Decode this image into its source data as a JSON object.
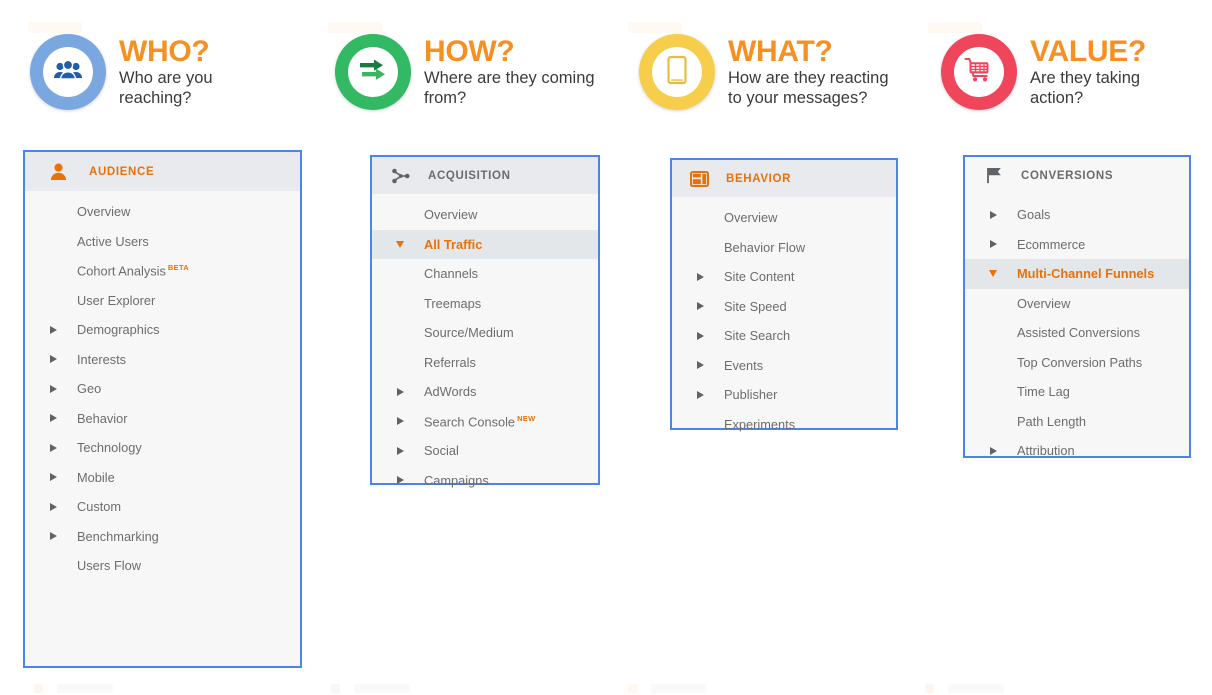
{
  "headers": [
    {
      "id": "who",
      "title": "WHO?",
      "subtitle": "Who are you\nreaching?",
      "icon": "people-icon",
      "ring_color": "#7ba7e1",
      "icon_color": "#1f5fa9"
    },
    {
      "id": "how",
      "title": "HOW?",
      "subtitle": "Where are they coming\nfrom?",
      "icon": "arrows-right-icon",
      "ring_color": "#33b864",
      "icon_color": "#1f7a3f"
    },
    {
      "id": "what",
      "title": "WHAT?",
      "subtitle": "How are they reacting\nto your messages?",
      "icon": "tablet-icon",
      "ring_color": "#f7ce4b",
      "icon_color": "#e5b63a"
    },
    {
      "id": "value",
      "title": "VALUE?",
      "subtitle": "Are they taking\naction?",
      "icon": "shopping-cart-icon",
      "ring_color": "#f0465c",
      "icon_color": "#f0465c"
    }
  ],
  "panels": [
    {
      "id": "audience",
      "header_label": "AUDIENCE",
      "header_icon": "person-icon",
      "header_label_color": "orange",
      "items": [
        {
          "label": "Overview",
          "arrow": "none",
          "selected": false,
          "tag": ""
        },
        {
          "label": "Active Users",
          "arrow": "none",
          "selected": false,
          "tag": ""
        },
        {
          "label": "Cohort Analysis",
          "arrow": "none",
          "selected": false,
          "tag": "BETA"
        },
        {
          "label": "User Explorer",
          "arrow": "none",
          "selected": false,
          "tag": ""
        },
        {
          "label": "Demographics",
          "arrow": "right",
          "selected": false,
          "tag": ""
        },
        {
          "label": "Interests",
          "arrow": "right",
          "selected": false,
          "tag": ""
        },
        {
          "label": "Geo",
          "arrow": "right",
          "selected": false,
          "tag": ""
        },
        {
          "label": "Behavior",
          "arrow": "right",
          "selected": false,
          "tag": ""
        },
        {
          "label": "Technology",
          "arrow": "right",
          "selected": false,
          "tag": ""
        },
        {
          "label": "Mobile",
          "arrow": "right",
          "selected": false,
          "tag": ""
        },
        {
          "label": "Custom",
          "arrow": "right",
          "selected": false,
          "tag": ""
        },
        {
          "label": "Benchmarking",
          "arrow": "right",
          "selected": false,
          "tag": ""
        },
        {
          "label": "Users Flow",
          "arrow": "none",
          "selected": false,
          "tag": ""
        }
      ]
    },
    {
      "id": "acquisition",
      "header_label": "ACQUISITION",
      "header_icon": "share-nodes-icon",
      "header_label_color": "grey",
      "items": [
        {
          "label": "Overview",
          "arrow": "none",
          "selected": false,
          "tag": ""
        },
        {
          "label": "All Traffic",
          "arrow": "down",
          "selected": true,
          "tag": ""
        },
        {
          "label": "Channels",
          "arrow": "none",
          "selected": false,
          "tag": ""
        },
        {
          "label": "Treemaps",
          "arrow": "none",
          "selected": false,
          "tag": ""
        },
        {
          "label": "Source/Medium",
          "arrow": "none",
          "selected": false,
          "tag": ""
        },
        {
          "label": "Referrals",
          "arrow": "none",
          "selected": false,
          "tag": ""
        },
        {
          "label": "AdWords",
          "arrow": "right",
          "selected": false,
          "tag": ""
        },
        {
          "label": "Search Console",
          "arrow": "right",
          "selected": false,
          "tag": "NEW"
        },
        {
          "label": "Social",
          "arrow": "right",
          "selected": false,
          "tag": ""
        },
        {
          "label": "Campaigns",
          "arrow": "right",
          "selected": false,
          "tag": ""
        }
      ]
    },
    {
      "id": "behavior",
      "header_label": "BEHAVIOR",
      "header_icon": "pages-icon",
      "header_label_color": "orange",
      "items": [
        {
          "label": "Overview",
          "arrow": "none",
          "selected": false,
          "tag": ""
        },
        {
          "label": "Behavior Flow",
          "arrow": "none",
          "selected": false,
          "tag": ""
        },
        {
          "label": "Site Content",
          "arrow": "right",
          "selected": false,
          "tag": ""
        },
        {
          "label": "Site Speed",
          "arrow": "right",
          "selected": false,
          "tag": ""
        },
        {
          "label": "Site Search",
          "arrow": "right",
          "selected": false,
          "tag": ""
        },
        {
          "label": "Events",
          "arrow": "right",
          "selected": false,
          "tag": ""
        },
        {
          "label": "Publisher",
          "arrow": "right",
          "selected": false,
          "tag": ""
        },
        {
          "label": "Experiments",
          "arrow": "none",
          "selected": false,
          "tag": ""
        }
      ]
    },
    {
      "id": "conversions",
      "header_label": "CONVERSIONS",
      "header_icon": "flag-icon",
      "header_label_color": "grey",
      "items": [
        {
          "label": "Goals",
          "arrow": "right",
          "selected": false,
          "tag": ""
        },
        {
          "label": "Ecommerce",
          "arrow": "right",
          "selected": false,
          "tag": ""
        },
        {
          "label": "Multi-Channel Funnels",
          "arrow": "down",
          "selected": true,
          "tag": ""
        },
        {
          "label": "Overview",
          "arrow": "none",
          "selected": false,
          "tag": ""
        },
        {
          "label": "Assisted Conversions",
          "arrow": "none",
          "selected": false,
          "tag": ""
        },
        {
          "label": "Top Conversion Paths",
          "arrow": "none",
          "selected": false,
          "tag": ""
        },
        {
          "label": "Time Lag",
          "arrow": "none",
          "selected": false,
          "tag": ""
        },
        {
          "label": "Path Length",
          "arrow": "none",
          "selected": false,
          "tag": ""
        },
        {
          "label": "Attribution",
          "arrow": "right",
          "selected": false,
          "tag": ""
        }
      ]
    }
  ],
  "colors": {
    "accent_orange": "#e8710a",
    "title_orange": "#f79022",
    "panel_border_blue": "#4a86e8",
    "panel_bg": "#f7f7f7",
    "panel_header_bg": "#e8eaed",
    "selected_row_bg": "#e4e7ea",
    "item_text": "#6d6d6d"
  }
}
